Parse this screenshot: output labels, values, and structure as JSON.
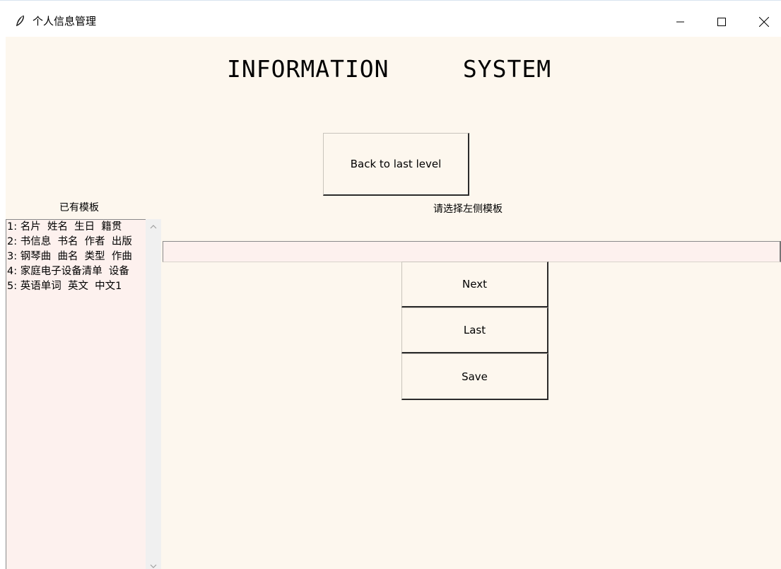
{
  "window": {
    "title": "个人信息管理",
    "icon": "feather-icon",
    "controls": [
      "minimize-icon",
      "maximize-icon",
      "close-icon"
    ]
  },
  "main": {
    "heading": "INFORMATION     SYSTEM",
    "back_button_label": "Back to last level",
    "templates_label": "已有模板",
    "select_hint": "请选择左侧模板",
    "entry_value": "",
    "next_label": "Next",
    "last_label": "Last",
    "save_label": "Save"
  },
  "templates": [
    "1: 名片  姓名  生日  籍贯",
    "2: 书信息  书名  作者  出版",
    "3: 钢琴曲  曲名  类型  作曲",
    "4: 家庭电子设备清单  设备",
    "5: 英语单词  英文  中文1"
  ],
  "colors": {
    "background": "#fdf7ee",
    "listbox": "#fdf1ee",
    "entry": "#fdf1ee"
  }
}
